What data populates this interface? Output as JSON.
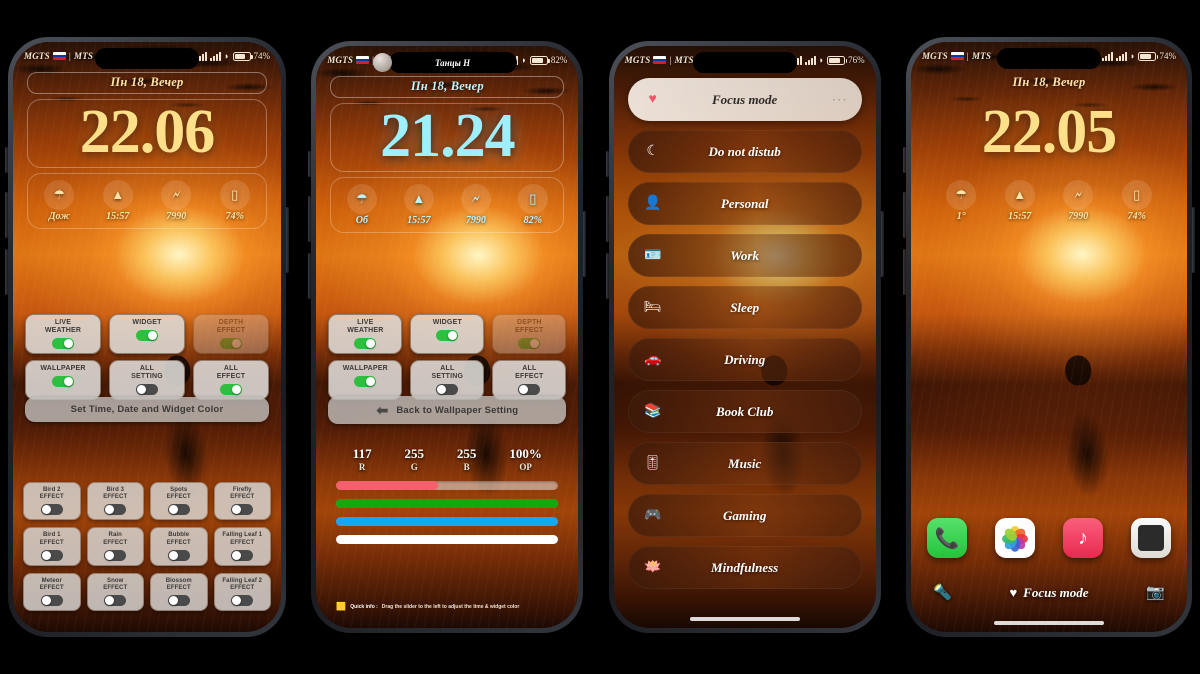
{
  "statusbars": {
    "carrier_primary": "MGTS",
    "carrier_secondary": "MTS",
    "separator": "|",
    "battery_1": "74%",
    "battery_2": "82%",
    "battery_3": "76%",
    "battery_4": "74%",
    "bluetooth_icon": "bluetooth-icon",
    "wifi_icon": "wifi-icon",
    "now_playing": "Танцы Н"
  },
  "lockscreen": {
    "date": "Пн 18, Вечер",
    "time_1": "22.06",
    "time_2": "21.24",
    "time_4": "22.05",
    "widgets_1": [
      {
        "icon": "☂",
        "text": "Дож",
        "name": "weather-rain"
      },
      {
        "icon": "▲",
        "text": "15:57",
        "name": "alarm"
      },
      {
        "icon": "🗲",
        "text": "7990",
        "name": "steps"
      },
      {
        "icon": "▯",
        "text": "74%",
        "name": "battery"
      }
    ],
    "widgets_2": [
      {
        "icon": "☂",
        "text": "Об",
        "name": "weather-cloud"
      },
      {
        "icon": "▲",
        "text": "15:57",
        "name": "alarm"
      },
      {
        "icon": "🗲",
        "text": "7990",
        "name": "steps"
      },
      {
        "icon": "▯",
        "text": "82%",
        "name": "battery"
      }
    ],
    "widgets_4": [
      {
        "icon": "☂",
        "text": "1°",
        "name": "weather-rain"
      },
      {
        "icon": "▲",
        "text": "15:57",
        "name": "alarm"
      },
      {
        "icon": "🗲",
        "text": "7990",
        "name": "steps"
      },
      {
        "icon": "▯",
        "text": "74%",
        "name": "battery"
      }
    ]
  },
  "phone1": {
    "chips": [
      {
        "label": "LIVE\nWEATHER",
        "state": "on",
        "faded": false,
        "name": "toggle-live-weather"
      },
      {
        "label": "WIDGET",
        "state": "on",
        "faded": false,
        "name": "toggle-widget"
      },
      {
        "label": "DEPTH\nEFFECT",
        "state": "on",
        "faded": true,
        "name": "toggle-depth-effect"
      },
      {
        "label": "WALLPAPER",
        "state": "on",
        "faded": false,
        "name": "toggle-wallpaper"
      },
      {
        "label": "ALL\nSETTING",
        "state": "off",
        "faded": false,
        "name": "toggle-all-setting"
      },
      {
        "label": "ALL\nEFFECT",
        "state": "on",
        "faded": false,
        "name": "toggle-all-effect"
      }
    ],
    "wide_button": "Set Time, Date and Widget Color",
    "effects": [
      {
        "label": "Bird 2\nEFFECT",
        "name": "effect-bird-2"
      },
      {
        "label": "Bird 3\nEFFECT",
        "name": "effect-bird-3"
      },
      {
        "label": "Spots\nEFFECT",
        "name": "effect-spots"
      },
      {
        "label": "Firefly\nEFFECT",
        "name": "effect-firefly"
      },
      {
        "label": "Bird 1\nEFFECT",
        "name": "effect-bird-1"
      },
      {
        "label": "Rain\nEFFECT",
        "name": "effect-rain"
      },
      {
        "label": "Bubble\nEFFECT",
        "name": "effect-bubble"
      },
      {
        "label": "Falling Leaf 1\nEFFECT",
        "name": "effect-falling-leaf-1"
      },
      {
        "label": "Meteor\nEFFECT",
        "name": "effect-meteor"
      },
      {
        "label": "Snow\nEFFECT",
        "name": "effect-snow"
      },
      {
        "label": "Blossom\nEFFECT",
        "name": "effect-blossom"
      },
      {
        "label": "Falling Leaf 2\nEFFECT",
        "name": "effect-falling-leaf-2"
      }
    ]
  },
  "phone2": {
    "chips": [
      {
        "label": "LIVE\nWEATHER",
        "state": "on",
        "faded": false,
        "name": "toggle-live-weather"
      },
      {
        "label": "WIDGET",
        "state": "on",
        "faded": false,
        "name": "toggle-widget"
      },
      {
        "label": "DEPTH\nEFFECT",
        "state": "on",
        "faded": true,
        "name": "toggle-depth-effect"
      },
      {
        "label": "WALLPAPER",
        "state": "on",
        "faded": false,
        "name": "toggle-wallpaper"
      },
      {
        "label": "ALL\nSETTING",
        "state": "off",
        "faded": false,
        "name": "toggle-all-setting"
      },
      {
        "label": "ALL\nEFFECT",
        "state": "off",
        "faded": false,
        "name": "toggle-all-effect"
      }
    ],
    "back_button": "Back to Wallpaper Setting",
    "color_picker": {
      "channels": [
        {
          "value": "117",
          "label": "R",
          "fill_pct": 46,
          "color": "#f4616c"
        },
        {
          "value": "255",
          "label": "G",
          "fill_pct": 100,
          "color": "#14a80d"
        },
        {
          "value": "255",
          "label": "B",
          "fill_pct": 100,
          "color": "#13a8f0"
        },
        {
          "value": "100%",
          "label": "OP",
          "fill_pct": 100,
          "color": "#ffffff"
        }
      ]
    },
    "quick_info_strong": "Quick info :",
    "quick_info": "Drag the slider to the left to adjust the time & widget color"
  },
  "phone3": {
    "items": [
      {
        "label": "Focus mode",
        "icon": "♥",
        "active": true,
        "name": "focus-item-focus-mode"
      },
      {
        "label": "Do not distub",
        "icon": "☾",
        "active": false,
        "name": "focus-item-do-not-disturb"
      },
      {
        "label": "Personal",
        "icon": "👤",
        "active": false,
        "name": "focus-item-personal"
      },
      {
        "label": "Work",
        "icon": "🪪",
        "active": false,
        "name": "focus-item-work"
      },
      {
        "label": "Sleep",
        "icon": "🛏",
        "active": false,
        "name": "focus-item-sleep"
      },
      {
        "label": "Driving",
        "icon": "🚗",
        "active": false,
        "name": "focus-item-driving"
      },
      {
        "label": "Book Club",
        "icon": "📚",
        "active": false,
        "name": "focus-item-book-club"
      },
      {
        "label": "Music",
        "icon": "🎚",
        "active": false,
        "name": "focus-item-music"
      },
      {
        "label": "Gaming",
        "icon": "🎮",
        "active": false,
        "name": "focus-item-gaming"
      },
      {
        "label": "Mindfulness",
        "icon": "🪷",
        "active": false,
        "name": "focus-item-mindfulness"
      }
    ],
    "more_dots": "···"
  },
  "phone4": {
    "dock": [
      {
        "name": "app-phone",
        "glyph": "📞"
      },
      {
        "name": "app-photos",
        "glyph": ""
      },
      {
        "name": "app-music",
        "glyph": "♪"
      },
      {
        "name": "app-calculator",
        "glyph": ""
      }
    ],
    "torch_icon": "🔦",
    "camera_icon": "📷",
    "focus_label": "Focus mode",
    "focus_heart": "♥"
  },
  "colors": {
    "accent_amber": "#ffe08a",
    "accent_cyan": "#9ff0ff",
    "toggle_on": "#2fbf3f",
    "toggle_off": "#4a4a4a",
    "slider_r": "#f4616c",
    "slider_g": "#14a80d",
    "slider_b": "#13a8f0",
    "heart_red": "#f2566b"
  }
}
